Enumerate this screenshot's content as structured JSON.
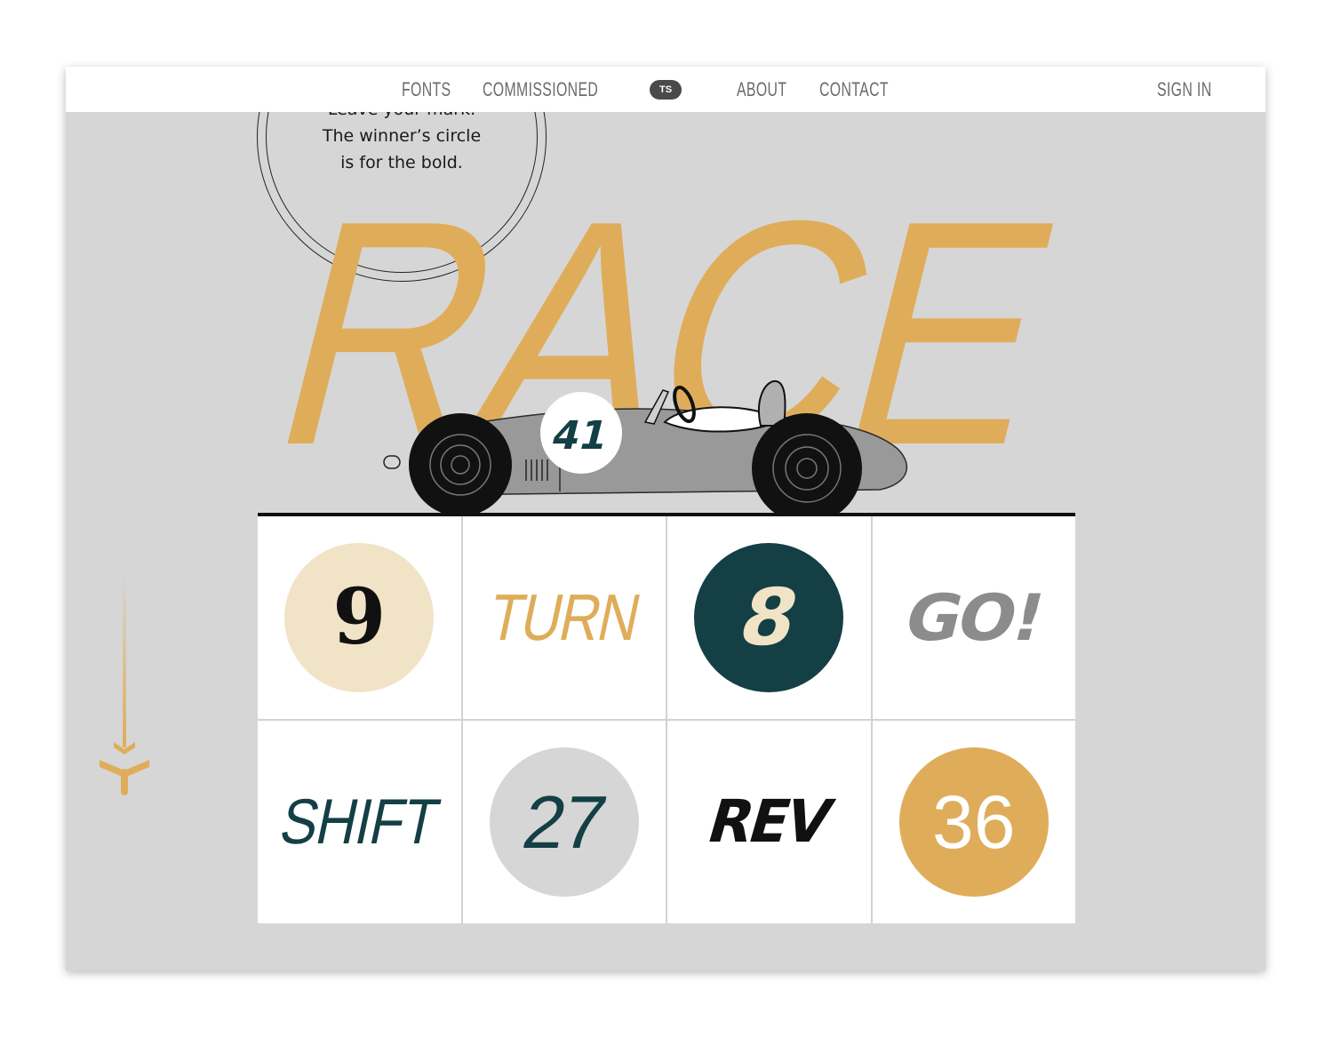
{
  "nav": {
    "links": [
      "FONTS",
      "COMMISSIONED",
      "ABOUT",
      "CONTACT"
    ],
    "logo": "TS",
    "sign_in": "SIGN IN"
  },
  "hero": {
    "tagline_lines": [
      "Leave your mark.",
      "The winner’s circle",
      "is for the bold."
    ],
    "headline": "RACE",
    "car_number": "41"
  },
  "grid": {
    "tiles": [
      "9",
      "TURN",
      "8",
      "GO!",
      "SHIFT",
      "27",
      "REV",
      "36"
    ]
  },
  "colors": {
    "gold": "#dfad5a",
    "teal": "#133f45",
    "beige": "#f1e3c6",
    "panel_grey": "#d6d6d6",
    "car_grey": "#999999"
  },
  "icons": [
    "scroll-down-arrow-icon"
  ]
}
